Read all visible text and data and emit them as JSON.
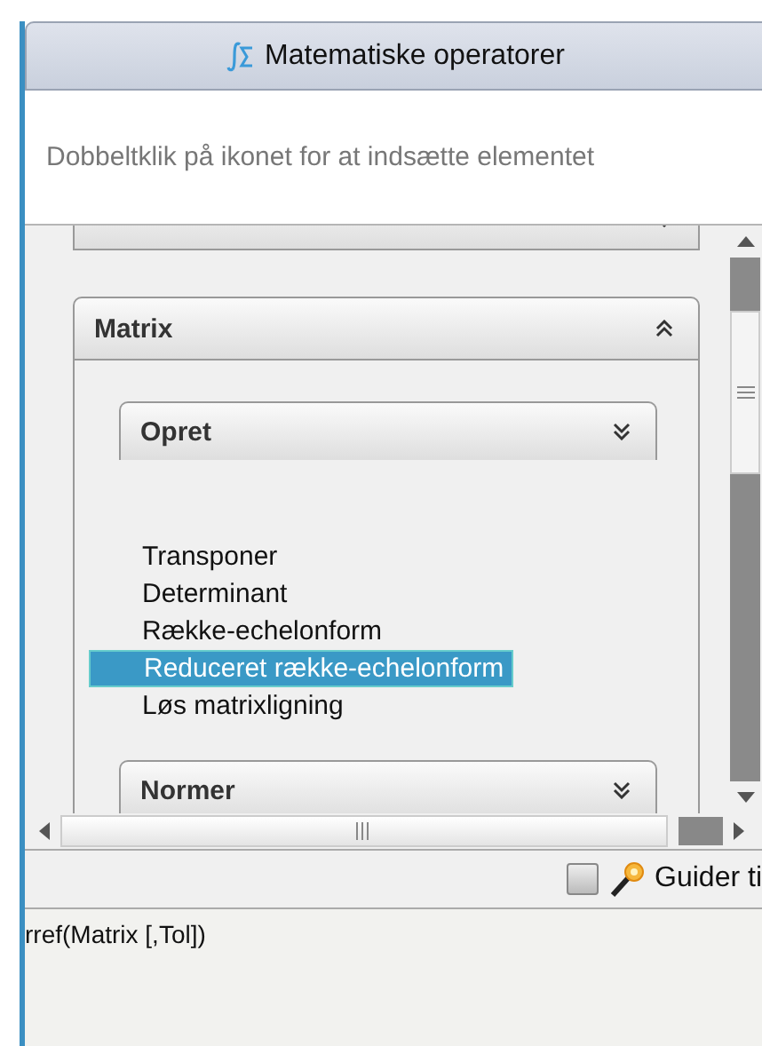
{
  "title": "Matematiske operatorer",
  "hint": "Dobbeltklik på ikonet for at indsætte elementet",
  "sections": [
    {
      "expanded": false
    },
    {
      "title": "Matrix",
      "expanded": true,
      "children": [
        {
          "kind": "group",
          "title": "Opret",
          "expanded": false
        },
        {
          "kind": "item",
          "label": "Transponer",
          "selected": false
        },
        {
          "kind": "item",
          "label": "Determinant",
          "selected": false
        },
        {
          "kind": "item",
          "label": "Række-echelonform",
          "selected": false
        },
        {
          "kind": "item",
          "label": "Reduceret række-echelonform",
          "selected": true
        },
        {
          "kind": "item",
          "label": "Løs matrixligning",
          "selected": false
        },
        {
          "kind": "group",
          "title": "Normer",
          "expanded": false
        }
      ]
    }
  ],
  "wizard": {
    "checked": false,
    "label": "Guider ti"
  },
  "syntax": "rref(Matrix [,Tol])"
}
